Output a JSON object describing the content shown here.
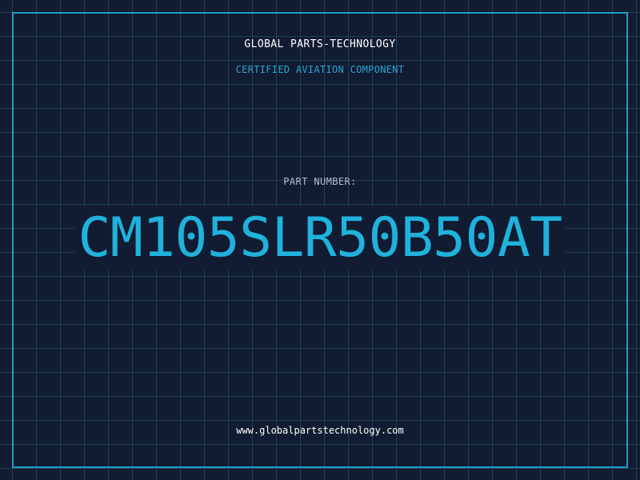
{
  "header": {
    "company": "GLOBAL PARTS-TECHNOLOGY",
    "tagline": "CERTIFIED AVIATION COMPONENT"
  },
  "part": {
    "label": "PART NUMBER:",
    "number": "CM105SLR50B50AT"
  },
  "footer": {
    "url": "www.globalpartstechnology.com"
  },
  "colors": {
    "background": "#111b31",
    "grid": "#1d4257",
    "frame": "#1e9ec4",
    "accent": "#1fb2dc",
    "muted_text": "#b4bccb"
  }
}
